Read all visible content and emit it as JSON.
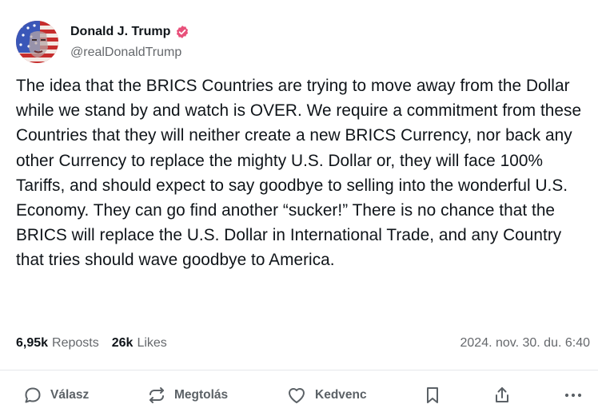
{
  "author": {
    "display_name": "Donald J. Trump",
    "handle": "@realDonaldTrump",
    "verified_icon": "verified-badge-icon",
    "verified_color": "#e8507a"
  },
  "post": {
    "text": "The idea that the BRICS Countries are trying to move away from the Dollar while we stand by and watch is OVER. We require a commitment from these Countries that they will neither create a new BRICS Currency, nor back any other Currency to replace the mighty U.S. Dollar or, they will face 100% Tariffs, and should expect to say goodbye to selling into the wonderful U.S. Economy. They can go find another “sucker!” There is no chance that the BRICS will replace the U.S. Dollar in International Trade, and any Country that tries should wave goodbye to America."
  },
  "stats": {
    "reposts_count": "6,95k",
    "reposts_label": "Reposts",
    "likes_count": "26k",
    "likes_label": "Likes",
    "timestamp": "2024. nov. 30. du. 6:40"
  },
  "actions": {
    "reply_label": "Válasz",
    "reply_icon": "reply-bubble-icon",
    "repost_label": "Megtolás",
    "repost_icon": "repost-arrows-icon",
    "like_label": "Kedvenc",
    "like_icon": "heart-icon",
    "bookmark_icon": "bookmark-icon",
    "share_icon": "share-icon",
    "more_icon": "more-dots-icon"
  }
}
